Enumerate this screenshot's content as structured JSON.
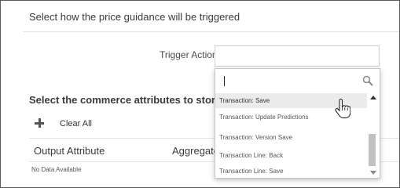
{
  "section1": {
    "title": "Select how the price guidance will be triggered"
  },
  "trigger": {
    "label": "Trigger Action",
    "value": ""
  },
  "section2": {
    "title": "Select the commerce attributes to store the"
  },
  "toolbar": {
    "add_icon": "plus-icon",
    "clear_all": "Clear All"
  },
  "table": {
    "columns": [
      "Output Attribute",
      "Aggregate"
    ],
    "empty_text": "No Data Available"
  },
  "dropdown": {
    "search_value": "",
    "search_icon": "search-icon",
    "items": [
      {
        "label": "Transaction: Save",
        "highlighted": true
      },
      {
        "label": "Transaction: Update Predictions",
        "highlighted": false
      },
      {
        "label": "Transaction: Version Save",
        "highlighted": false
      },
      {
        "label": "Transaction Line: Back",
        "highlighted": false
      },
      {
        "label": "Transaction Line: Save",
        "highlighted": false
      }
    ]
  }
}
